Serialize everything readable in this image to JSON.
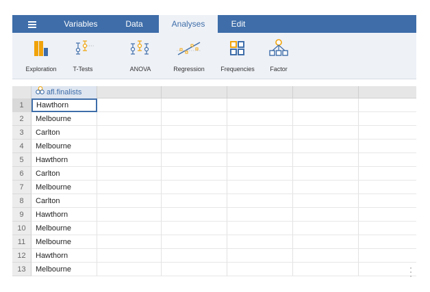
{
  "tabs": {
    "menu_icon": "hamburger-icon",
    "items": [
      {
        "label": "Variables"
      },
      {
        "label": "Data"
      },
      {
        "label": "Analyses"
      },
      {
        "label": "Edit"
      }
    ],
    "active": "Analyses"
  },
  "ribbon": {
    "buttons": [
      {
        "label": "Exploration",
        "icon": "bar-chart-icon"
      },
      {
        "label": "T-Tests",
        "icon": "t-test-icon"
      },
      {
        "label": "ANOVA",
        "icon": "anova-icon"
      },
      {
        "label": "Regression",
        "icon": "regression-icon"
      },
      {
        "label": "Frequencies",
        "icon": "frequencies-icon"
      },
      {
        "label": "Factor",
        "icon": "factor-icon"
      }
    ]
  },
  "sheet": {
    "columns": [
      {
        "name": "afl.finalists",
        "icon": "nominal-variable-icon"
      }
    ],
    "rows": [
      {
        "n": "1",
        "value": "Hawthorn"
      },
      {
        "n": "2",
        "value": "Melbourne"
      },
      {
        "n": "3",
        "value": "Carlton"
      },
      {
        "n": "4",
        "value": "Melbourne"
      },
      {
        "n": "5",
        "value": "Hawthorn"
      },
      {
        "n": "6",
        "value": "Carlton"
      },
      {
        "n": "7",
        "value": "Melbourne"
      },
      {
        "n": "8",
        "value": "Carlton"
      },
      {
        "n": "9",
        "value": "Hawthorn"
      },
      {
        "n": "10",
        "value": "Melbourne"
      },
      {
        "n": "11",
        "value": "Melbourne"
      },
      {
        "n": "12",
        "value": "Hawthorn"
      },
      {
        "n": "13",
        "value": "Melbourne"
      }
    ],
    "selected_cell": {
      "row": 1,
      "column": "afl.finalists"
    }
  },
  "colors": {
    "accent": "#3e6da9",
    "ribbon_bg": "#eef1f6",
    "chart_orange": "#f0a30a"
  }
}
